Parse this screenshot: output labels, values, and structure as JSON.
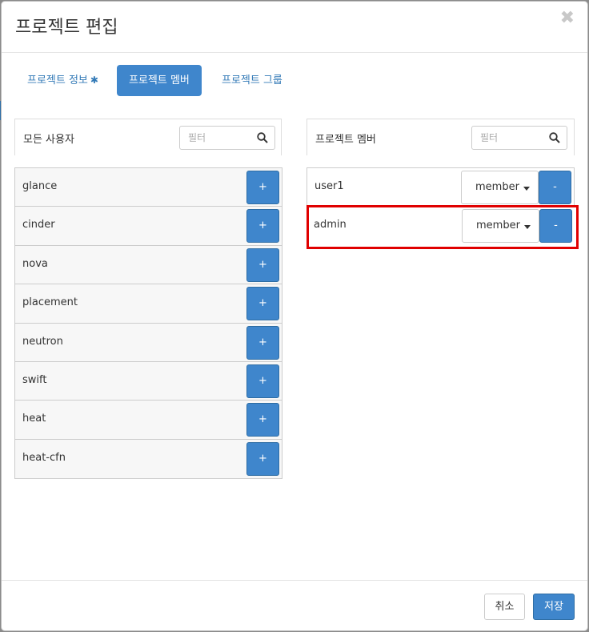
{
  "modal": {
    "title": "프로젝트 편집",
    "close_glyph": "✖"
  },
  "tabs": [
    {
      "label": "프로젝트 정보",
      "required_mark": "✱"
    },
    {
      "label": "프로젝트 멤버"
    },
    {
      "label": "프로젝트 그룹"
    }
  ],
  "all_users": {
    "title": "모든 사용자",
    "filter_placeholder": "필터",
    "add_label": "+",
    "items": [
      "glance",
      "cinder",
      "nova",
      "placement",
      "neutron",
      "swift",
      "heat",
      "heat-cfn"
    ]
  },
  "members": {
    "title": "프로젝트 멤버",
    "filter_placeholder": "필터",
    "remove_label": "-",
    "items": [
      {
        "name": "user1",
        "role": "member"
      },
      {
        "name": "admin",
        "role": "member"
      }
    ]
  },
  "footer": {
    "cancel_label": "취소",
    "save_label": "저장"
  },
  "colors": {
    "primary": "#3f86cc",
    "link": "#337ab7",
    "highlight": "#e00000"
  }
}
